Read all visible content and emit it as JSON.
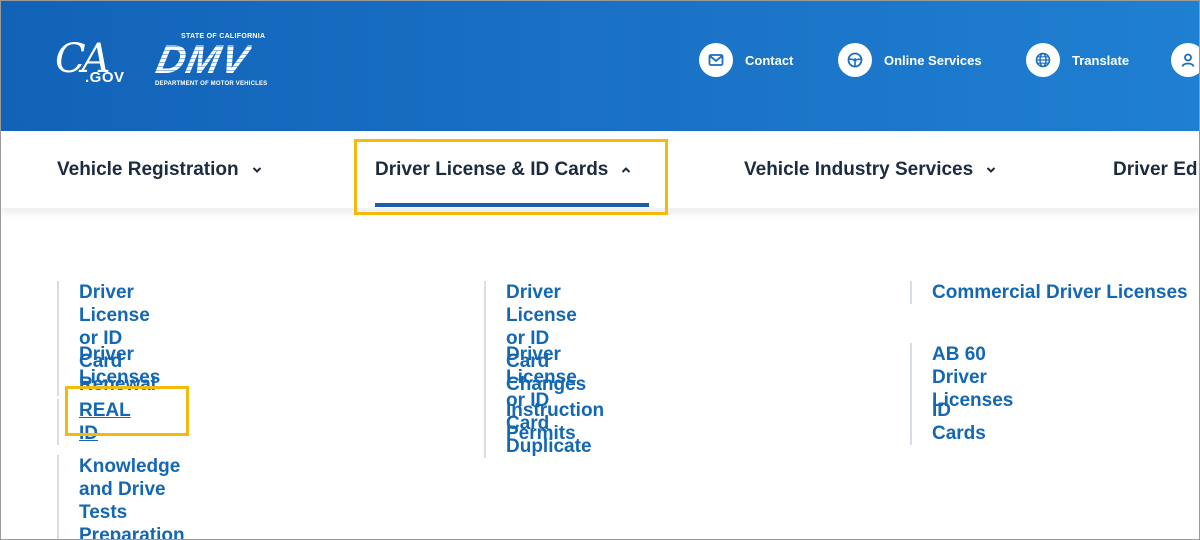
{
  "header": {
    "ca_logo": {
      "ca": "CA",
      "gov": ".GOV"
    },
    "dmv_logo": {
      "state": "STATE OF CALIFORNIA",
      "mark": "DMV",
      "dept": "DEPARTMENT OF MOTOR VEHICLES"
    },
    "links": [
      {
        "label": "Contact",
        "icon": "envelope-icon"
      },
      {
        "label": "Online Services",
        "icon": "steering-wheel-icon"
      },
      {
        "label": "Translate",
        "icon": "globe-icon"
      },
      {
        "label": "",
        "icon": "user-icon"
      }
    ]
  },
  "nav": {
    "items": [
      {
        "label": "Vehicle Registration",
        "state": "collapsed"
      },
      {
        "label": "Driver License & ID Cards",
        "state": "expanded"
      },
      {
        "label": "Vehicle Industry Services",
        "state": "collapsed"
      },
      {
        "label": "Driver Ed"
      }
    ]
  },
  "dropdown": {
    "columns": [
      [
        "Driver License or ID Card Renewal",
        "Driver Licenses",
        "REAL ID",
        "Knowledge and Drive Tests",
        "Preparation"
      ],
      [
        "Driver License or ID Card Changes",
        "Driver License or ID Card Duplicate",
        "Instruction Permits"
      ],
      [
        "Commercial Driver Licenses",
        "AB 60 Driver Licenses",
        "ID Cards"
      ]
    ]
  },
  "colors": {
    "header_blue": "#1a72c6",
    "link_blue": "#1467b3",
    "nav_text": "#1c2b3e",
    "highlight": "#f5b90c",
    "underline": "#1a5fa8"
  }
}
